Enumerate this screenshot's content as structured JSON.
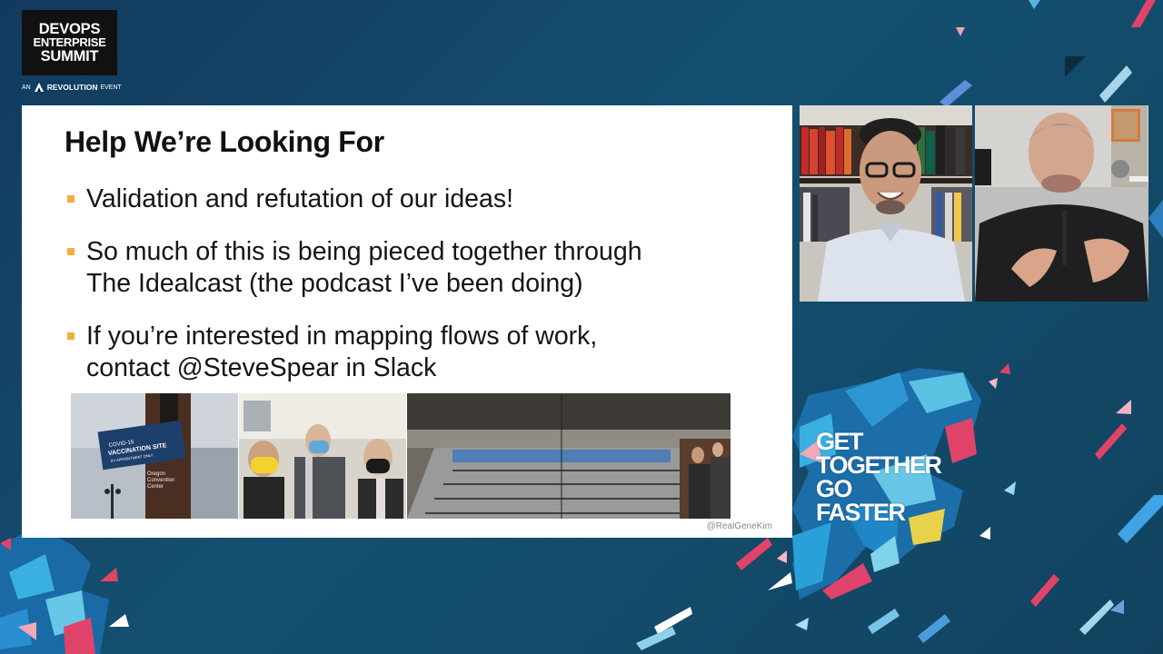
{
  "logo": {
    "line1": "DEVOPS",
    "line2": "ENTERPRISE",
    "line3": "SUMMIT",
    "tagline_prefix": "AN",
    "tagline_brand": "REVOLUTION",
    "tagline_suffix": "EVENT"
  },
  "slide": {
    "title": "Help We’re Looking For",
    "bullets": [
      "Validation and refutation of our ideas!",
      "So much of this is being pieced together through\nThe Idealcast (the podcast I’ve been doing)",
      "If you’re interested in mapping flows of work,\ncontact @SteveSpear in Slack"
    ],
    "photo_sign_lines": [
      "COVID-19",
      "VACCINATION SITE",
      "BY APPOINTMENT ONLY"
    ],
    "photo_caption_lines": [
      "Oregon",
      "Convention",
      "Center"
    ],
    "credit": "@RealGeneKim"
  },
  "slogan": {
    "line1": "GET",
    "line2": "TOGETHER",
    "line3": "GO",
    "line4": "FASTER"
  },
  "colors": {
    "bullet_accent": "#f4ad3d",
    "background": "#145071"
  }
}
